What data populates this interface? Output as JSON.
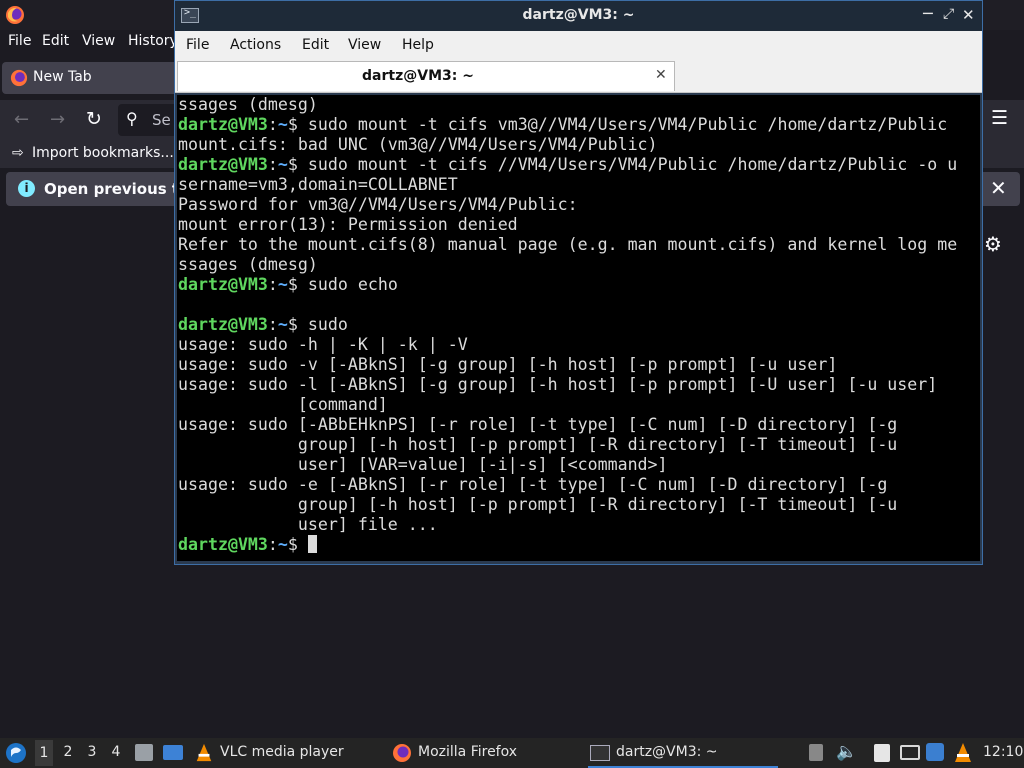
{
  "firefox": {
    "menu": [
      "File",
      "Edit",
      "View",
      "History"
    ],
    "tab_label": "New Tab",
    "search_placeholder": "Se",
    "bookmarks_label": "Import bookmarks...",
    "notification": "Open previous ta"
  },
  "terminal": {
    "window_title": "dartz@VM3: ~",
    "tab_title": "dartz@VM3: ~",
    "menu": [
      "File",
      "Actions",
      "Edit",
      "View",
      "Help"
    ],
    "prompt": {
      "user": "dartz@VM3",
      "sep": ":",
      "path": "~",
      "symbol": "$"
    },
    "lines": [
      {
        "text": "ssages (dmesg)"
      },
      {
        "prompt": true,
        "text": " sudo mount -t cifs vm3@//VM4/Users/VM4/Public /home/dartz/Public"
      },
      {
        "text": "mount.cifs: bad UNC (vm3@//VM4/Users/VM4/Public)"
      },
      {
        "prompt": true,
        "text": " sudo mount -t cifs //VM4/Users/VM4/Public /home/dartz/Public -o u"
      },
      {
        "text": "sername=vm3,domain=COLLABNET"
      },
      {
        "text": "Password for vm3@//VM4/Users/VM4/Public:"
      },
      {
        "text": "mount error(13): Permission denied"
      },
      {
        "text": "Refer to the mount.cifs(8) manual page (e.g. man mount.cifs) and kernel log me"
      },
      {
        "text": "ssages (dmesg)"
      },
      {
        "prompt": true,
        "text": " sudo echo"
      },
      {
        "text": ""
      },
      {
        "prompt": true,
        "text": " sudo"
      },
      {
        "text": "usage: sudo -h | -K | -k | -V"
      },
      {
        "text": "usage: sudo -v [-ABknS] [-g group] [-h host] [-p prompt] [-u user]"
      },
      {
        "text": "usage: sudo -l [-ABknS] [-g group] [-h host] [-p prompt] [-U user] [-u user]"
      },
      {
        "text": "            [command]"
      },
      {
        "text": "usage: sudo [-ABbEHknPS] [-r role] [-t type] [-C num] [-D directory] [-g"
      },
      {
        "text": "            group] [-h host] [-p prompt] [-R directory] [-T timeout] [-u"
      },
      {
        "text": "            user] [VAR=value] [-i|-s] [<command>]"
      },
      {
        "text": "usage: sudo -e [-ABknS] [-r role] [-t type] [-C num] [-D directory] [-g"
      },
      {
        "text": "            group] [-h host] [-p prompt] [-R directory] [-T timeout] [-u"
      },
      {
        "text": "            user] file ..."
      },
      {
        "prompt": true,
        "text": " ",
        "cursor": true
      }
    ]
  },
  "taskbar": {
    "workspaces": [
      "1",
      "2",
      "3",
      "4"
    ],
    "active_workspace": "1",
    "tasks": [
      {
        "label": "VLC media player",
        "icon": "vlc-icon"
      },
      {
        "label": "Mozilla Firefox",
        "icon": "firefox-icon"
      },
      {
        "label": "dartz@VM3: ~",
        "icon": "terminal-icon"
      }
    ],
    "clock": "12:10"
  },
  "colors": {
    "prompt_user": "#5fd75f",
    "prompt_path": "#5fafff",
    "terminal_bg": "#000000",
    "taskbar_bg": "#242424",
    "firefox_bg": "#1c1b22",
    "focus_border": "#3d6ea6"
  }
}
